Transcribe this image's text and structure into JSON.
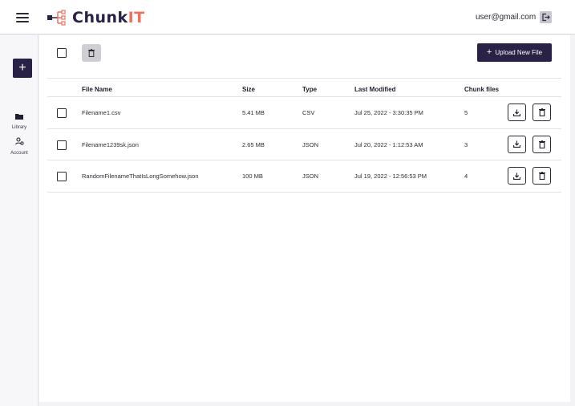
{
  "header": {
    "logo_text_main": "Chunk",
    "logo_text_accent": "IT",
    "user_email": "user@gmail.com",
    "icons": {
      "menu": "hamburger-menu-icon",
      "logout": "logout-icon"
    }
  },
  "sidebar": {
    "new_button_label": "+",
    "items": [
      {
        "label": "Library",
        "icon": "folder-icon"
      },
      {
        "label": "Account",
        "icon": "account-icon"
      }
    ]
  },
  "toolbar": {
    "upload_label": "Upload New File",
    "upload_plus": "+",
    "bulk_delete_icon": "trash-icon"
  },
  "table": {
    "columns": [
      "File Name",
      "Size",
      "Type",
      "Last Modified",
      "Chunk files"
    ],
    "rows": [
      {
        "name": "Filename1.csv",
        "size": "5.41 MB",
        "type": "CSV",
        "modified": "Jul 25, 2022 - 3:30:35 PM",
        "chunks": "5"
      },
      {
        "name": "Filename1239sk.json",
        "size": "2.65 MB",
        "type": "JSON",
        "modified": "Jul 20, 2022 - 1:12:53 AM",
        "chunks": "3"
      },
      {
        "name": "RandomFilenameThatIsLongSomehow.json",
        "size": "100 MB",
        "type": "JSON",
        "modified": "Jul 19, 2022 - 12:56:53 PM",
        "chunks": "4"
      }
    ],
    "row_actions": [
      "download-icon",
      "trash-icon"
    ]
  },
  "colors": {
    "brand_dark": "#2a2146",
    "brand_accent": "#f0705e",
    "bulk_delete_bg": "#cfcfd3",
    "logout_bg": "#c9c6d2"
  }
}
